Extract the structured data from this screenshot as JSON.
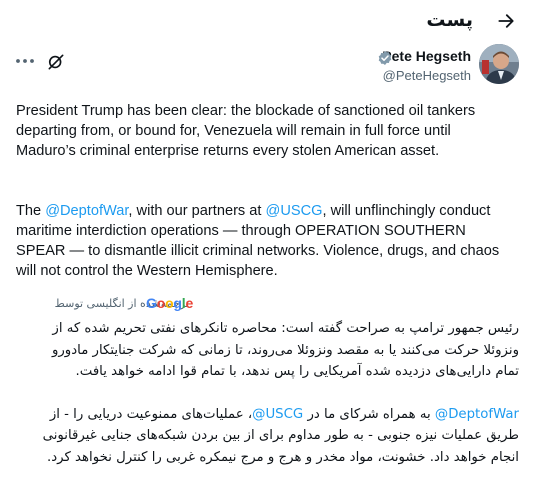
{
  "header": {
    "title": "پست",
    "back_icon": "arrow-right-icon"
  },
  "author": {
    "name": "Pete Hegseth",
    "handle": "@PeteHegseth",
    "verified_color": "#829aab",
    "more_icon": "more-dots-icon",
    "grok_icon": "grok-icon"
  },
  "tweet": {
    "para1_lines": [
      "President Trump has been clear: the blockade of sanctioned oil tankers",
      "departing from, or bound for, Venezuela will remain in full force until",
      "Maduro’s criminal enterprise returns every stolen American asset."
    ],
    "para2_line1_prefix": "The ",
    "para2_mention1": "@DeptofWar",
    "para2_line1_mid": ", with our partners at ",
    "para2_mention2": "@USCG",
    "para2_line1_suffix": ", will unflinchingly conduct",
    "para2_lines": [
      "maritime interdiction operations — through OPERATION SOUTHERN",
      "SPEAR — to dismantle illicit criminal networks. Violence, drugs, and chaos",
      "will not control the Western Hemisphere."
    ]
  },
  "translation": {
    "attribution": "ترجمه‌شده از انگلیسی توسط",
    "provider": "Google",
    "provider_colors": [
      "#4285f4",
      "#ea4335",
      "#fbbc05",
      "#4285f4",
      "#34a853",
      "#ea4335"
    ],
    "para1_lines": [
      "رئیس جمهور ترامپ به صراحت گفته است: محاصره تانکرهای نفتی تحریم شده که از",
      "ونزوئلا حرکت می‌کنند یا به مقصد ونزوئلا می‌روند، تا زمانی که شرکت جنایتکار مادورو",
      "تمام دارایی‌های دزدیده شده آمریکایی را پس ندهد، با تمام قوا ادامه خواهد یافت."
    ],
    "para2_mention1": "@DeptofWar",
    "para2_line1_mid": " به همراه شرکای ما در ",
    "para2_mention2": "@USCG",
    "para2_line1_suffix": "، عملیات‌های ممنوعیت دریایی را - از",
    "para2_lines": [
      "طریق عملیات نیزه جنوبی - به طور مداوم برای از بین بردن شبکه‌های جنایی غیرقانونی",
      "انجام خواهد داد. خشونت، مواد مخدر و هرج و مرج نیمکره غربی را کنترل نخواهد کرد."
    ]
  }
}
